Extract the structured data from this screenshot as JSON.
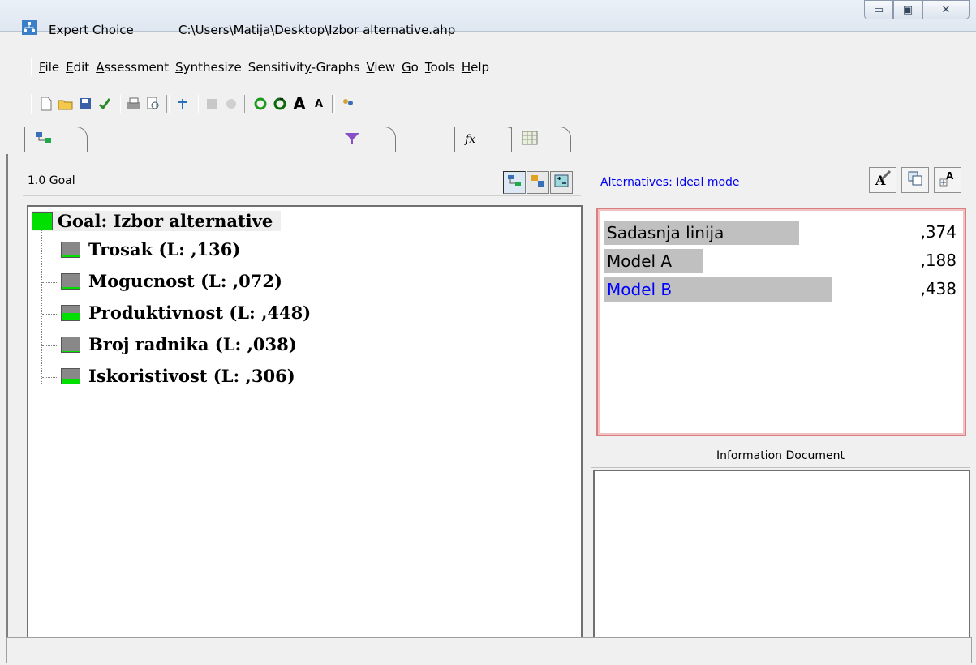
{
  "window": {
    "app_name": "Expert Choice",
    "file_path": "C:\\Users\\Matija\\Desktop\\Izbor alternative.ahp",
    "controls": {
      "minimize": "▭",
      "maximize": "▣",
      "close": "✕"
    }
  },
  "menu": [
    {
      "u": "F",
      "rest": "ile"
    },
    {
      "u": "E",
      "rest": "dit"
    },
    {
      "u": "A",
      "rest": "ssessment"
    },
    {
      "u": "S",
      "rest": "ynthesize"
    },
    {
      "pre": "Sensitivit",
      "u": "y",
      "rest": "-Graphs"
    },
    {
      "u": "V",
      "rest": "iew"
    },
    {
      "u": "G",
      "rest": "o"
    },
    {
      "u": "T",
      "rest": "ools"
    },
    {
      "u": "H",
      "rest": "elp"
    }
  ],
  "toolbar_icons": [
    "new-file-icon",
    "open-folder-icon",
    "save-icon",
    "check-icon",
    "print-icon",
    "print-preview-icon",
    "tree-icon",
    "disabled-a-icon",
    "disabled-b-icon",
    "refresh-icon",
    "refresh-alt-icon",
    "font-larger-icon",
    "font-smaller-icon",
    "users-icon"
  ],
  "left_pane": {
    "node_label": "1.0 Goal",
    "goal": "Goal: Izbor alternative",
    "criteria": [
      {
        "label": "Trosak (L: ,136)",
        "weight": 0.136
      },
      {
        "label": "Mogucnost (L: ,072)",
        "weight": 0.072
      },
      {
        "label": "Produktivnost (L: ,448)",
        "weight": 0.448
      },
      {
        "label": "Broj radnika (L: ,038)",
        "weight": 0.038
      },
      {
        "label": "Iskoristivost (L: ,306)",
        "weight": 0.306
      }
    ]
  },
  "right_pane": {
    "mode_link": "Alternatives: Ideal mode",
    "alternatives": [
      {
        "name": "Sadasnja linija",
        "value": ",374",
        "score": 0.374,
        "color": "#000000"
      },
      {
        "name": "Model A",
        "value": ",188",
        "score": 0.188,
        "color": "#000000"
      },
      {
        "name": "Model B",
        "value": ",438",
        "score": 0.438,
        "color": "#0000ff"
      }
    ],
    "info_header": "Information Document"
  },
  "colors": {
    "goal_green": "#00e000",
    "selected_border": "#d88080"
  }
}
